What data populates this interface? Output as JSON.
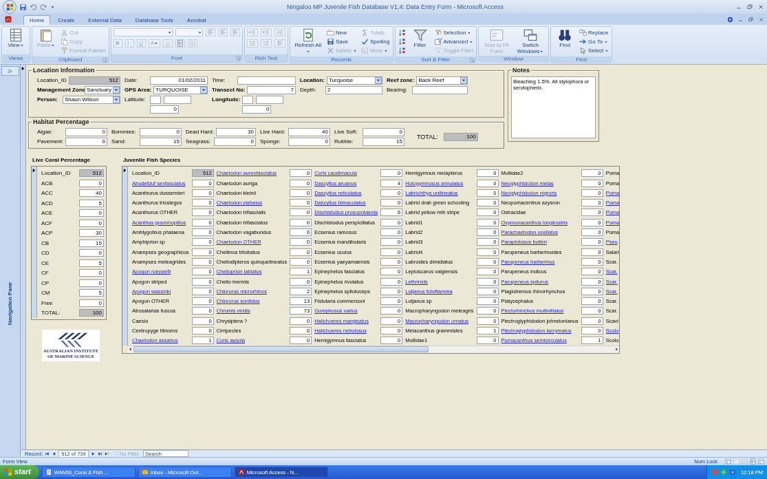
{
  "title_bar": {
    "title": "Ningaloo MP Juvenile Fish Database V1.4: Data Entry Form - Microsoft Access"
  },
  "ribbon": {
    "tabs": [
      {
        "label": "Home",
        "selected": true
      },
      {
        "label": "Create",
        "selected": false
      },
      {
        "label": "External Data",
        "selected": false
      },
      {
        "label": "Database Tools",
        "selected": false
      },
      {
        "label": "Acrobat",
        "selected": false
      }
    ],
    "groups": [
      {
        "label": "Views",
        "kind": "standard",
        "launcher": false,
        "buttons": [
          {
            "label": "View",
            "kind": "large",
            "disabled": false,
            "dropdown": true
          }
        ]
      },
      {
        "label": "Clipboard",
        "kind": "standard",
        "launcher": true,
        "buttons": [
          {
            "label": "Paste",
            "kind": "large",
            "disabled": true,
            "dropdown": true
          },
          {
            "label": "Cut",
            "kind": "small",
            "disabled": true,
            "dropdown": false
          },
          {
            "label": "Copy",
            "kind": "small",
            "disabled": true,
            "dropdown": false
          },
          {
            "label": "Format Painter",
            "kind": "small",
            "disabled": true,
            "dropdown": false
          }
        ]
      },
      {
        "label": "Font",
        "kind": "font",
        "launcher": true,
        "buttons": [
          {
            "label": "B",
            "kind": "small",
            "disabled": true,
            "dropdown": false
          },
          {
            "label": "I",
            "kind": "small",
            "disabled": true,
            "dropdown": false
          },
          {
            "label": "U",
            "kind": "small",
            "disabled": true,
            "dropdown": false
          },
          {
            "label": "A",
            "kind": "small",
            "disabled": true,
            "dropdown": true
          }
        ]
      },
      {
        "label": "Rich Text",
        "kind": "richtext",
        "launcher": false
      },
      {
        "label": "Records",
        "kind": "standard",
        "launcher": false,
        "buttons": [
          {
            "label": "Refresh All",
            "kind": "large",
            "disabled": false,
            "dropdown": true
          },
          {
            "label": "New",
            "kind": "small",
            "disabled": false,
            "dropdown": false
          },
          {
            "label": "Save",
            "kind": "small",
            "disabled": false,
            "dropdown": false
          },
          {
            "label": "Delete",
            "kind": "small",
            "disabled": true,
            "dropdown": true
          },
          {
            "label": "Totals",
            "kind": "small",
            "disabled": true,
            "dropdown": false
          },
          {
            "label": "Spelling",
            "kind": "small",
            "disabled": false,
            "dropdown": false
          },
          {
            "label": "More",
            "kind": "small",
            "disabled": true,
            "dropdown": true
          }
        ]
      },
      {
        "label": "Sort & Filter",
        "kind": "sort",
        "launcher": true,
        "buttons": [
          {
            "label": "Filter",
            "kind": "large",
            "disabled": false,
            "dropdown": false
          },
          {
            "label": "Selection",
            "kind": "small",
            "disabled": false,
            "dropdown": true
          },
          {
            "label": "Advanced",
            "kind": "small",
            "disabled": false,
            "dropdown": true
          },
          {
            "label": "Toggle Filter",
            "kind": "small",
            "disabled": true,
            "dropdown": false
          }
        ]
      },
      {
        "label": "Window",
        "kind": "standard",
        "launcher": false,
        "buttons": [
          {
            "label": "Size to Fit Form",
            "kind": "large",
            "disabled": true,
            "dropdown": false
          },
          {
            "label": "Switch Windows",
            "kind": "large",
            "disabled": false,
            "dropdown": true
          }
        ]
      },
      {
        "label": "Find",
        "kind": "standard",
        "launcher": false,
        "buttons": [
          {
            "label": "Find",
            "kind": "large",
            "disabled": false,
            "dropdown": false
          },
          {
            "label": "Replace",
            "kind": "small",
            "disabled": false,
            "dropdown": false
          },
          {
            "label": "Go To",
            "kind": "small",
            "disabled": false,
            "dropdown": true
          },
          {
            "label": "Select",
            "kind": "small",
            "disabled": false,
            "dropdown": true
          }
        ]
      }
    ]
  },
  "navigation_pane": {
    "label": "Navigation Pane"
  },
  "location_information": {
    "title": "Location Information",
    "rows": [
      {
        "fields": [
          {
            "label": "Location_ID",
            "kind": "readonly",
            "value": "512",
            "bold": false
          },
          {
            "label": "Date:",
            "kind": "date",
            "value": "01/02/2011",
            "bold": false
          },
          {
            "label": "Time:",
            "kind": "text",
            "bold": false
          },
          {
            "label": "Location:",
            "kind": "combo",
            "value": "Turquoise",
            "bold": true
          },
          {
            "label": "Reef zone:",
            "kind": "combo",
            "value": "Back Reef",
            "bold": true
          }
        ]
      },
      {
        "fields": [
          {
            "label": "Management Zone",
            "kind": "combo",
            "value": "Sanctuary",
            "bold": true
          },
          {
            "label": "GPS Area:",
            "kind": "combo",
            "value": "TURQUOISE",
            "bold": true
          },
          {
            "label": "Transect No:",
            "kind": "number",
            "value": "7",
            "bold": true
          },
          {
            "label": "Depth:",
            "kind": "text",
            "value": "2",
            "bold": false
          },
          {
            "label": "Bearing:",
            "kind": "text",
            "bold": false
          }
        ]
      },
      {
        "fields": [
          {
            "label": "Person:",
            "kind": "combo",
            "value": "Shaun Wilson",
            "bold": true
          },
          {
            "label": "Latitude:",
            "kind": "coord",
            "value": "0",
            "bold": false
          },
          {
            "label": "Longitude:",
            "kind": "coord",
            "value": "0",
            "bold": true
          }
        ]
      }
    ]
  },
  "notes": {
    "title": "Notes",
    "text": "Bleaching 1-5%. All stylophora or serotopherix."
  },
  "habitat_percentage": {
    "title": "Habitat Percentage",
    "fields": [
      {
        "label": "Algae:",
        "value": "0"
      },
      {
        "label": "Bommies:",
        "value": "0"
      },
      {
        "label": "Dead Hard:",
        "value": "30"
      },
      {
        "label": "Live Hard:",
        "value": "40"
      },
      {
        "label": "Live Soft:",
        "value": "0"
      },
      {
        "label": "Pavement:",
        "value": "0"
      },
      {
        "label": "Sand:",
        "value": "15"
      },
      {
        "label": "Seagrass:",
        "value": "0"
      },
      {
        "label": "Sponge:",
        "value": "0"
      },
      {
        "label": "Rubble:",
        "value": "15"
      }
    ],
    "total": {
      "label": "TOTAL:",
      "value": "100"
    }
  },
  "live_coral_percentage": {
    "title": "Live Coral Percentage",
    "rows": [
      {
        "label": "Location_ID",
        "value": "512",
        "kind": "readonly"
      },
      {
        "label": "ACB",
        "value": "0",
        "kind": "number"
      },
      {
        "label": "ACC",
        "value": "40",
        "kind": "number"
      },
      {
        "label": "ACD",
        "value": "5",
        "kind": "number"
      },
      {
        "label": "ACE",
        "value": "0",
        "kind": "number"
      },
      {
        "label": "ACF",
        "value": "0",
        "kind": "number"
      },
      {
        "label": "ACP",
        "value": "30",
        "kind": "number"
      },
      {
        "label": "CB",
        "value": "15",
        "kind": "number"
      },
      {
        "label": "CD",
        "value": "0",
        "kind": "number"
      },
      {
        "label": "CE",
        "value": "5",
        "kind": "number"
      },
      {
        "label": "CF",
        "value": "0",
        "kind": "number"
      },
      {
        "label": "CP",
        "value": "0",
        "kind": "number"
      },
      {
        "label": "CM",
        "value": "5",
        "kind": "number"
      },
      {
        "label": "Free",
        "value": "0",
        "kind": "number"
      },
      {
        "label": "TOTAL:",
        "value": "100",
        "kind": "readonly"
      }
    ]
  },
  "logo": {
    "lines": [
      "AUSTRALIAN INSTITUTE",
      "OF MARINE SCIENCE"
    ]
  },
  "juvenile_fish_species": {
    "title": "Juvenile Fish Species",
    "columns": [
      {
        "items": [
          {
            "label": "Location_ID",
            "value": "512",
            "kind": "readonly",
            "linked": false
          },
          {
            "label": "Abudefduf sexfasciatus",
            "value": "0",
            "kind": "number",
            "linked": true
          },
          {
            "label": "Acanthurus dussemieri",
            "value": "0",
            "kind": "number",
            "linked": false
          },
          {
            "label": "Acanthurus triostegus",
            "value": "0",
            "kind": "number",
            "linked": false
          },
          {
            "label": "Acanthurus OTHER",
            "value": "0",
            "kind": "number",
            "linked": false
          },
          {
            "label": "Acanthus grammoptilus",
            "value": "0",
            "kind": "number",
            "linked": true
          },
          {
            "label": "Amblygobius phalaena",
            "value": "0",
            "kind": "number",
            "linked": false
          },
          {
            "label": "Amphiprion sp",
            "value": "0",
            "kind": "number",
            "linked": false
          },
          {
            "label": "Anampses geographicus",
            "value": "0",
            "kind": "number",
            "linked": false
          },
          {
            "label": "Anampses meleagrides",
            "value": "0",
            "kind": "number",
            "linked": false
          },
          {
            "label": "Apogon rueppelli",
            "value": "0",
            "kind": "number",
            "linked": true
          },
          {
            "label": "Apogon striped",
            "value": "0",
            "kind": "number",
            "linked": false
          },
          {
            "label": "Apogon wassinki",
            "value": "0",
            "kind": "number",
            "linked": true
          },
          {
            "label": "Apogon OTHER",
            "value": "0",
            "kind": "number",
            "linked": false
          },
          {
            "label": "Atrosalarias fuscus",
            "value": "0",
            "kind": "number",
            "linked": false
          },
          {
            "label": "Caesio",
            "value": "0",
            "kind": "number",
            "linked": false
          },
          {
            "label": "Centropyge tibicens",
            "value": "0",
            "kind": "number",
            "linked": false
          },
          {
            "label": "Chaetodon assarius",
            "value": "1",
            "kind": "number",
            "linked": true
          }
        ]
      },
      {
        "items": [
          {
            "label": "Chaetodon aureofasciatus",
            "value": "0",
            "kind": "number",
            "linked": true
          },
          {
            "label": "Chaetodon auriga",
            "value": "0",
            "kind": "number",
            "linked": false
          },
          {
            "label": "Chaetodon kleinii",
            "value": "0",
            "kind": "number",
            "linked": false
          },
          {
            "label": "Chaetodon plebeius",
            "value": "0",
            "kind": "number",
            "linked": true
          },
          {
            "label": "Chaetodon trifascialis",
            "value": "0",
            "kind": "number",
            "linked": false
          },
          {
            "label": "Chaetodon trifasciatus",
            "value": "0",
            "kind": "number",
            "linked": false
          },
          {
            "label": "Chaetodon vagabundus",
            "value": "0",
            "kind": "number",
            "linked": false
          },
          {
            "label": "Chaetodon OTHER",
            "value": "0",
            "kind": "number",
            "linked": true
          },
          {
            "label": "Cheilinus trilobatus",
            "value": "0",
            "kind": "number",
            "linked": false
          },
          {
            "label": "Cheilodipterus quinquelineatus",
            "value": "0",
            "kind": "number",
            "linked": false
          },
          {
            "label": "Cheiloprion labiatus",
            "value": "1",
            "kind": "number",
            "linked": true
          },
          {
            "label": "Cheilo inermis",
            "value": "0",
            "kind": "number",
            "linked": false
          },
          {
            "label": "Chlorurus microrhinos",
            "value": "2",
            "kind": "number",
            "linked": true
          },
          {
            "label": "Chlorurus sordidus",
            "value": "13",
            "kind": "number",
            "linked": true
          },
          {
            "label": "Chromis viridis",
            "value": "73",
            "kind": "number",
            "linked": true
          },
          {
            "label": "Chrysiptera ?",
            "value": "0",
            "kind": "number",
            "linked": false
          },
          {
            "label": "Cirripectes",
            "value": "0",
            "kind": "number",
            "linked": false
          },
          {
            "label": "Coris aygula",
            "value": "0",
            "kind": "number",
            "linked": true
          }
        ]
      },
      {
        "items": [
          {
            "label": "Coris caudimacula",
            "value": "0",
            "kind": "number",
            "linked": true
          },
          {
            "label": "Dascyllus aruanus",
            "value": "4",
            "kind": "number",
            "linked": true
          },
          {
            "label": "Dascyllus reticulatus",
            "value": "0",
            "kind": "number",
            "linked": true
          },
          {
            "label": "Dascyllus trimaculatus",
            "value": "0",
            "kind": "number",
            "linked": true
          },
          {
            "label": "Dischistodus prosopotaenia",
            "value": "6",
            "kind": "number",
            "linked": true
          },
          {
            "label": "Dischistodus perspicillatus",
            "value": "0",
            "kind": "number",
            "linked": false
          },
          {
            "label": "Ecsenius ramosus",
            "value": "0",
            "kind": "number",
            "linked": false
          },
          {
            "label": "Ecsenius mandibularis",
            "value": "0",
            "kind": "number",
            "linked": false
          },
          {
            "label": "Ecsenius oculus",
            "value": "0",
            "kind": "number",
            "linked": false
          },
          {
            "label": "Ecsenius yaeyamaensis",
            "value": "0",
            "kind": "number",
            "linked": false
          },
          {
            "label": "Epinephelus fasciatus",
            "value": "0",
            "kind": "number",
            "linked": false
          },
          {
            "label": "Epinephelus rivulatus",
            "value": "0",
            "kind": "number",
            "linked": false
          },
          {
            "label": "Epinephelus spilotoceps",
            "value": "0",
            "kind": "number",
            "linked": false
          },
          {
            "label": "Fistularia commersoni",
            "value": "0",
            "kind": "number",
            "linked": false
          },
          {
            "label": "Gomphosus varius",
            "value": "0",
            "kind": "number",
            "linked": true
          },
          {
            "label": "Halichoeres marginatus",
            "value": "0",
            "kind": "number",
            "linked": true
          },
          {
            "label": "Halichoeres nebulosus",
            "value": "0",
            "kind": "number",
            "linked": true
          },
          {
            "label": "Hemigymnus fasciatus",
            "value": "0",
            "kind": "number",
            "linked": false
          }
        ]
      },
      {
        "items": [
          {
            "label": "Hemigymnus melapterus",
            "value": "0",
            "kind": "number",
            "linked": false
          },
          {
            "label": "Hologymnosus annulatus",
            "value": "0",
            "kind": "number",
            "linked": true
          },
          {
            "label": "Labrichthys unilineatus",
            "value": "0",
            "kind": "number",
            "linked": true
          },
          {
            "label": "Labrid drab green schooling",
            "value": "0",
            "kind": "number",
            "linked": false
          },
          {
            "label": "Labrid yellow mth stripe",
            "value": "0",
            "kind": "number",
            "linked": false
          },
          {
            "label": "Labrid1",
            "value": "0",
            "kind": "number",
            "linked": false
          },
          {
            "label": "Labrid2",
            "value": "0",
            "kind": "number",
            "linked": false
          },
          {
            "label": "Labrid3",
            "value": "0",
            "kind": "number",
            "linked": false
          },
          {
            "label": "Labrid4",
            "value": "0",
            "kind": "number",
            "linked": false
          },
          {
            "label": "Labroides dimidiatus",
            "value": "0",
            "kind": "number",
            "linked": false
          },
          {
            "label": "Leptoscarus vaigiensis",
            "value": "0",
            "kind": "number",
            "linked": false
          },
          {
            "label": "Lethrinids",
            "value": "0",
            "kind": "number",
            "linked": true
          },
          {
            "label": "Lutjanus fulviflamma",
            "value": "0",
            "kind": "number",
            "linked": true
          },
          {
            "label": "Lutjanus sp",
            "value": "0",
            "kind": "number",
            "linked": false
          },
          {
            "label": "Macropharyngodon meleagris",
            "value": "0",
            "kind": "number",
            "linked": false
          },
          {
            "label": "Macropharyngodon ornatus",
            "value": "0",
            "kind": "number",
            "linked": true
          },
          {
            "label": "Meiacanthus grammistes",
            "value": "1",
            "kind": "number",
            "linked": false
          },
          {
            "label": "Mullidae1",
            "value": "0",
            "kind": "number",
            "linked": false
          }
        ]
      },
      {
        "items": [
          {
            "label": "Mullidae2",
            "value": "0",
            "kind": "number",
            "linked": false
          },
          {
            "label": "Neoglyphidodon melas",
            "value": "0",
            "kind": "number",
            "linked": true
          },
          {
            "label": "Neoglyphidodon nigroris",
            "value": "0",
            "kind": "number",
            "linked": true
          },
          {
            "label": "Neopomacentrus azysron",
            "value": "0",
            "kind": "number",
            "linked": false
          },
          {
            "label": "Ostracidae",
            "value": "0",
            "kind": "number",
            "linked": false
          },
          {
            "label": "Oxymonacanthus longirostris",
            "value": "0",
            "kind": "number",
            "linked": true
          },
          {
            "label": "Parachaetodon ocellatus",
            "value": "0",
            "kind": "number",
            "linked": true
          },
          {
            "label": "Paraplotosus butleri",
            "value": "0",
            "kind": "number",
            "linked": true
          },
          {
            "label": "Parupeneus barberinoides",
            "value": "0",
            "kind": "number",
            "linked": false
          },
          {
            "label": "Parupeneus barberinus",
            "value": "0",
            "kind": "number",
            "linked": true
          },
          {
            "label": "Parupeneus indicus",
            "value": "0",
            "kind": "number",
            "linked": false
          },
          {
            "label": "Parupeneus spilurus",
            "value": "0",
            "kind": "number",
            "linked": true
          },
          {
            "label": "Plagiotremus rhinorhynchos",
            "value": "0",
            "kind": "number",
            "linked": false
          },
          {
            "label": "Platycephalus",
            "value": "0",
            "kind": "number",
            "linked": false
          },
          {
            "label": "Plectorhinchus multivittatus",
            "value": "0",
            "kind": "number",
            "linked": true
          },
          {
            "label": "Plectroglyphidodon johnstonianus",
            "value": "0",
            "kind": "number",
            "linked": false
          },
          {
            "label": "Plectroglyphidodon lacrymatus",
            "value": "0",
            "kind": "number",
            "linked": true
          },
          {
            "label": "Pomacanthus semicirculatus",
            "value": "1",
            "kind": "number",
            "linked": true
          }
        ]
      },
      {
        "items": [
          {
            "label": "Poma",
            "kind": "cut",
            "linked": false
          },
          {
            "label": "Poma",
            "kind": "cut",
            "linked": false
          },
          {
            "label": "Poma",
            "kind": "cut",
            "linked": true
          },
          {
            "label": "Poma",
            "kind": "cut",
            "linked": true
          },
          {
            "label": "Poma",
            "kind": "cut",
            "linked": true
          },
          {
            "label": "Poma",
            "kind": "cut",
            "linked": true
          },
          {
            "label": "Poma",
            "kind": "cut",
            "linked": false
          },
          {
            "label": "Pseu",
            "kind": "cut",
            "linked": true
          },
          {
            "label": "Salari",
            "kind": "cut",
            "linked": false
          },
          {
            "label": "Scar.",
            "kind": "cut",
            "linked": false
          },
          {
            "label": "Scar.",
            "kind": "cut",
            "linked": true
          },
          {
            "label": "Scar.",
            "kind": "cut",
            "linked": true
          },
          {
            "label": "Scar.",
            "kind": "cut",
            "linked": true
          },
          {
            "label": "Scar.",
            "kind": "cut",
            "linked": false
          },
          {
            "label": "Scar.",
            "kind": "cut",
            "linked": false
          },
          {
            "label": "Scavi",
            "kind": "cut",
            "linked": false
          },
          {
            "label": "Scolo",
            "kind": "cut",
            "linked": true
          },
          {
            "label": "Scolo",
            "kind": "cut",
            "linked": false
          }
        ]
      }
    ]
  },
  "record_navigation": {
    "label": "Record:",
    "position": "512 of 739",
    "filter": {
      "label": "No Filter",
      "disabled": true
    },
    "search": {
      "placeholder": "Search"
    }
  },
  "status_bar": {
    "left": "Form View",
    "indicator": "Num Lock"
  },
  "taskbar": {
    "start": "start",
    "tasks": [
      {
        "label": "WAMSI_Coral & Fish ...",
        "selected": false
      },
      {
        "label": "Inbox - Microsoft Out...",
        "selected": false
      },
      {
        "label": "Microsoft Access - N...",
        "selected": true
      }
    ],
    "clock": "12:18 PM"
  }
}
